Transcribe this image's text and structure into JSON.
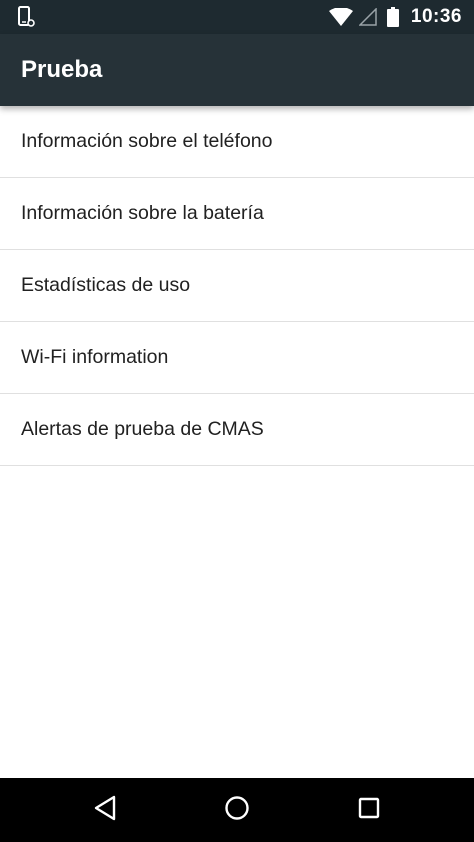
{
  "status_bar": {
    "time": "10:36",
    "icons": [
      "phone-debug-icon",
      "wifi-icon",
      "signal-icon",
      "battery-icon"
    ]
  },
  "app_bar": {
    "title": "Prueba"
  },
  "list": {
    "items": [
      {
        "label": "Información sobre el teléfono"
      },
      {
        "label": "Información sobre la batería"
      },
      {
        "label": "Estadísticas de uso"
      },
      {
        "label": "Wi-Fi information"
      },
      {
        "label": "Alertas de prueba de CMAS"
      }
    ]
  },
  "nav_bar": {
    "icons": [
      "back-icon",
      "home-icon",
      "recents-icon"
    ]
  },
  "colors": {
    "status_bar": "#1e2a30",
    "app_bar": "#263238",
    "text_primary": "#212121",
    "divider": "#e0e0e0",
    "nav_bar": "#000000"
  }
}
